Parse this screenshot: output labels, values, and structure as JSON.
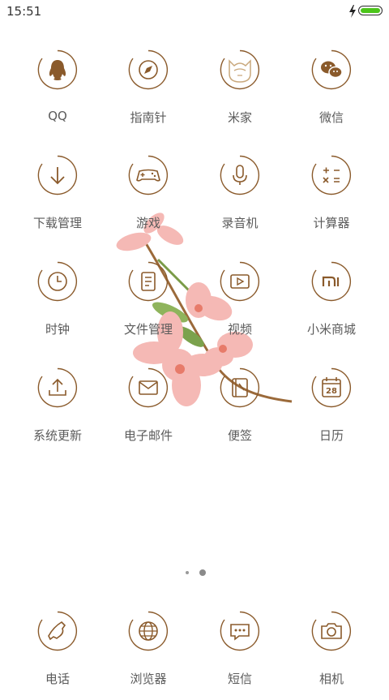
{
  "status_bar": {
    "time": "15:51",
    "charging": true,
    "battery_color": "#4cc51a"
  },
  "accent_color": "#8a5a2b",
  "apps": [
    {
      "label": "QQ",
      "icon": "qq-penguin-icon"
    },
    {
      "label": "指南针",
      "icon": "compass-icon"
    },
    {
      "label": "米家",
      "icon": "mijia-icon"
    },
    {
      "label": "微信",
      "icon": "wechat-icon"
    },
    {
      "label": "下载管理",
      "icon": "download-icon"
    },
    {
      "label": "游戏",
      "icon": "gamepad-icon"
    },
    {
      "label": "录音机",
      "icon": "microphone-icon"
    },
    {
      "label": "计算器",
      "icon": "calculator-icon"
    },
    {
      "label": "时钟",
      "icon": "clock-icon"
    },
    {
      "label": "文件管理",
      "icon": "file-manager-icon"
    },
    {
      "label": "视频",
      "icon": "video-play-icon"
    },
    {
      "label": "小米商城",
      "icon": "mi-store-icon"
    },
    {
      "label": "系统更新",
      "icon": "upload-icon"
    },
    {
      "label": "电子邮件",
      "icon": "mail-icon"
    },
    {
      "label": "便签",
      "icon": "notes-icon"
    },
    {
      "label": "日历",
      "icon": "calendar-icon",
      "day": "28"
    }
  ],
  "page_indicator": {
    "pages": 2,
    "current": 2
  },
  "dock": [
    {
      "label": "电话",
      "icon": "phone-icon"
    },
    {
      "label": "浏览器",
      "icon": "globe-icon"
    },
    {
      "label": "短信",
      "icon": "message-icon"
    },
    {
      "label": "相机",
      "icon": "camera-icon"
    }
  ]
}
